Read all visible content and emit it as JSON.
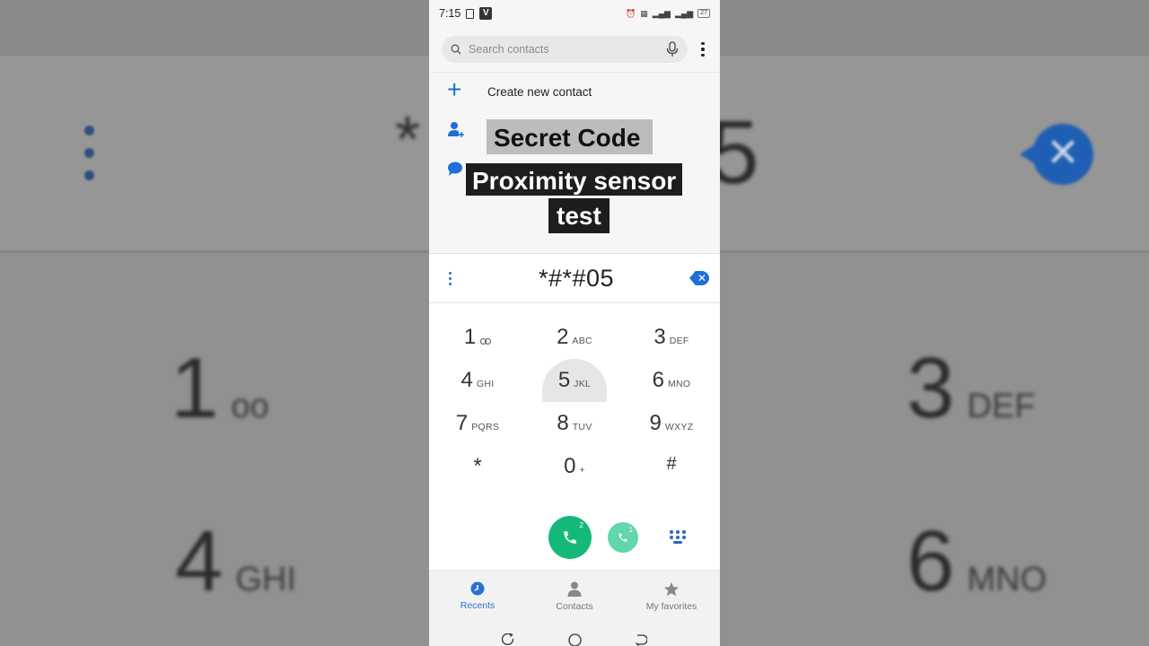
{
  "status_bar": {
    "time": "7:15",
    "battery": "27"
  },
  "search": {
    "placeholder": "Search contacts"
  },
  "suggestions": {
    "create_new_contact": "Create new contact"
  },
  "overlay": {
    "line1": "Secret Code",
    "line2": "Proximity sensor",
    "line3": "test"
  },
  "dialer": {
    "entered_number": "*#*#05"
  },
  "keypad": {
    "rows": [
      [
        {
          "num": "1",
          "letters": ""
        },
        {
          "num": "2",
          "letters": "ABC"
        },
        {
          "num": "3",
          "letters": "DEF"
        }
      ],
      [
        {
          "num": "4",
          "letters": "GHI"
        },
        {
          "num": "5",
          "letters": "JKL"
        },
        {
          "num": "6",
          "letters": "MNO"
        }
      ],
      [
        {
          "num": "7",
          "letters": "PQRS"
        },
        {
          "num": "8",
          "letters": "TUV"
        },
        {
          "num": "9",
          "letters": "WXYZ"
        }
      ],
      [
        {
          "num": "*",
          "letters": ""
        },
        {
          "num": "0",
          "letters": "+"
        },
        {
          "num": "#",
          "letters": ""
        }
      ]
    ]
  },
  "call_buttons": {
    "sim_primary": "2",
    "sim_secondary": "1"
  },
  "tabs": [
    {
      "label": "Recents",
      "icon": "clock-icon"
    },
    {
      "label": "Contacts",
      "icon": "person-icon"
    },
    {
      "label": "My favorites",
      "icon": "star-icon"
    }
  ],
  "background": {
    "ghost_1": "1",
    "ghost_3": "3",
    "ghost_3_letters": "DEF",
    "ghost_4": "4",
    "ghost_4_letters": "GHI",
    "ghost_6": "6",
    "ghost_6_letters": "MNO",
    "ghost_star": "*",
    "ghost_5": "5"
  },
  "colors": {
    "accent": "#1f6fd6",
    "call_green": "#16b87a",
    "call_green_light": "#62d7a9"
  }
}
